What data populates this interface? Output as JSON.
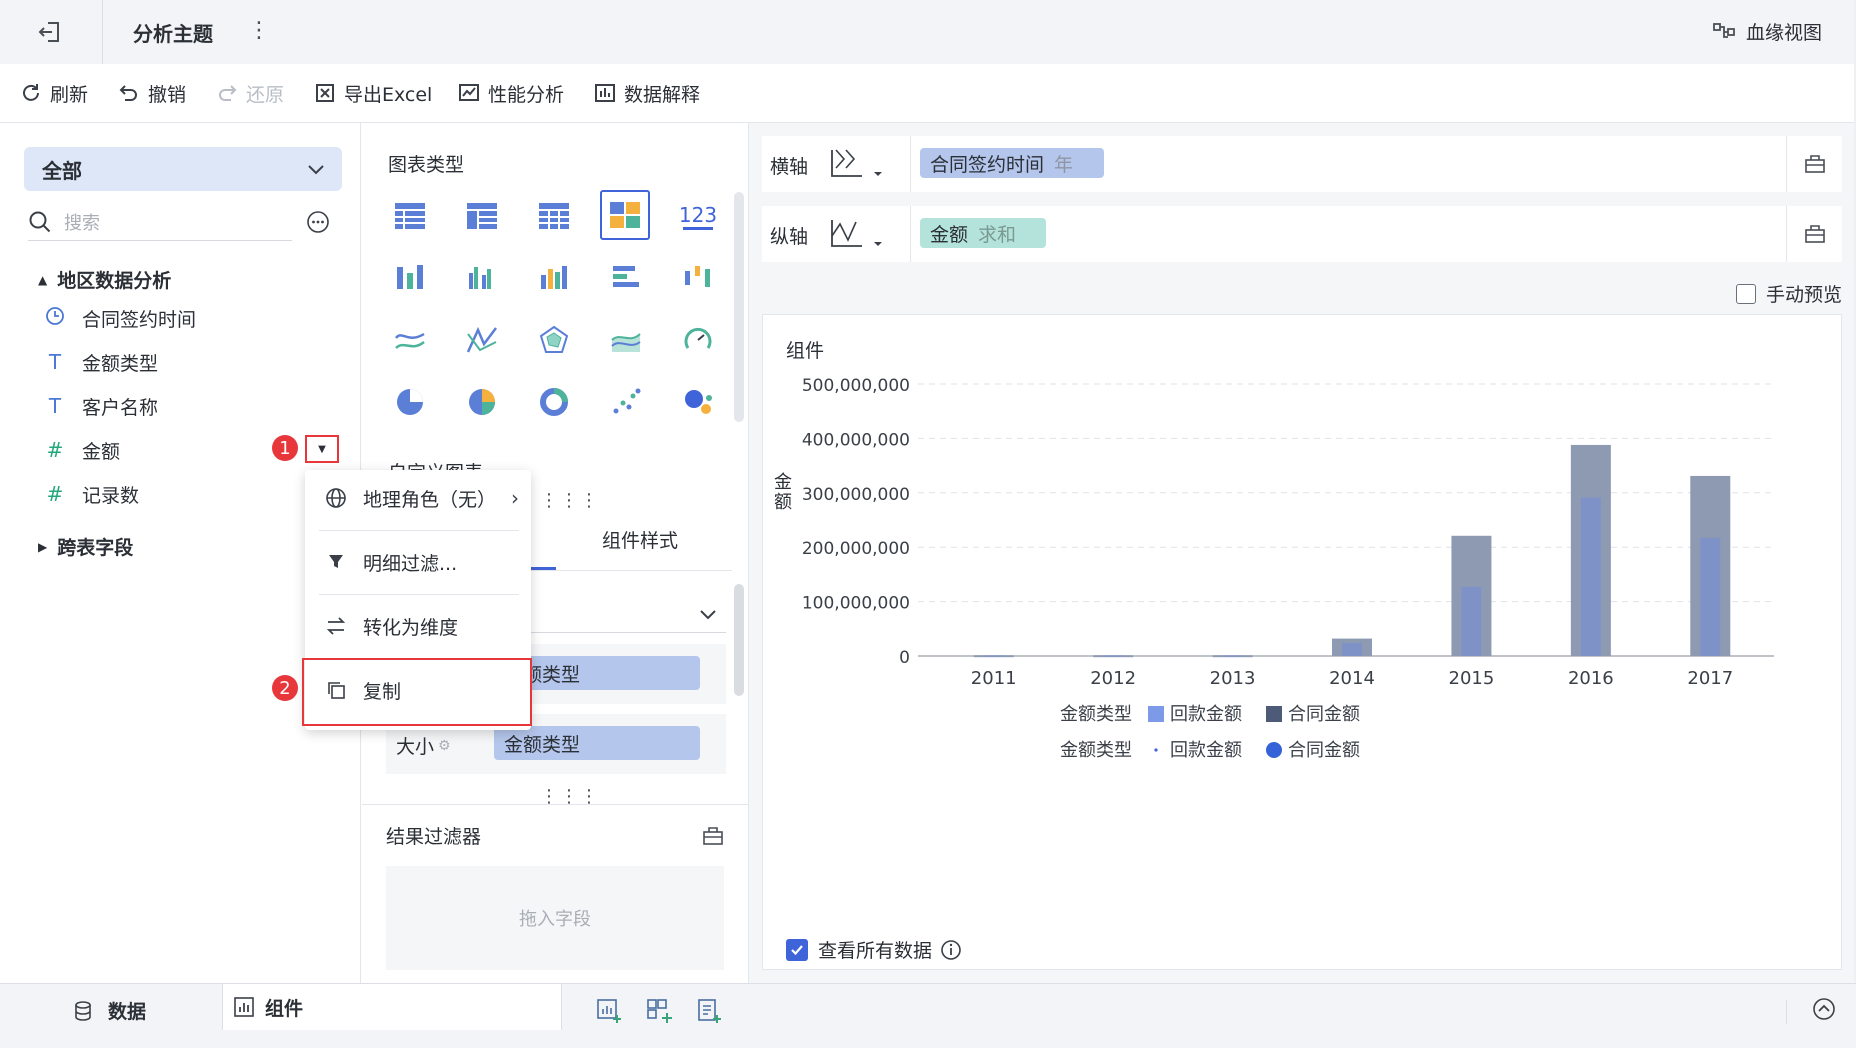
{
  "header": {
    "title": "分析主题",
    "lineage_label": "血缘视图"
  },
  "toolbar": {
    "refresh": "刷新",
    "undo": "撤销",
    "redo": "还原",
    "export_excel": "导出Excel",
    "performance": "性能分析",
    "data_explain": "数据解释"
  },
  "left": {
    "dropdown_value": "全部",
    "search_placeholder": "搜索",
    "folder": "地区数据分析",
    "fields": [
      {
        "label": "合同签约时间",
        "icon": "clock-icon"
      },
      {
        "label": "金额类型",
        "icon": "text-type-icon"
      },
      {
        "label": "客户名称",
        "icon": "text-type-icon"
      },
      {
        "label": "金额",
        "icon": "number-type-icon"
      },
      {
        "label": "记录数",
        "icon": "number-calc-icon"
      }
    ],
    "cross_table": "跨表字段"
  },
  "context_menu": {
    "geo_role": "地理角色（无）",
    "detail_filter": "明细过滤...",
    "to_dimension": "转化为维度",
    "copy": "复制"
  },
  "annotations": {
    "step1": "1",
    "step2": "2"
  },
  "middle": {
    "chart_type_title": "图表类型",
    "number_icon_text": "123",
    "custom_chart_partial": "自定义图表",
    "tab_component_style": "组件样式",
    "mark_color_field": "金额类型",
    "size_label": "大小",
    "size_field": "金额类型",
    "result_filter_title": "结果过滤器",
    "drop_placeholder": "拖入字段"
  },
  "axes": {
    "x_label": "横轴",
    "y_label": "纵轴",
    "x_field": "合同签约时间",
    "x_field_suffix": "年",
    "y_field": "金额",
    "y_field_suffix": "求和",
    "manual_preview": "手动预览"
  },
  "chart_card": {
    "title": "组件",
    "view_all_data": "查看所有数据"
  },
  "chart_data": {
    "type": "bar",
    "ylabel": "金额",
    "ylim": [
      0,
      500000000
    ],
    "yticks": [
      "500,000,000",
      "400,000,000",
      "300,000,000",
      "200,000,000",
      "100,000,000",
      "0"
    ],
    "categories": [
      "2011",
      "2012",
      "2013",
      "2014",
      "2015",
      "2016",
      "2017"
    ],
    "series": [
      {
        "name": "合同金额",
        "color": "#8e9ab2",
        "values": [
          1500000,
          1500000,
          1500000,
          32000000,
          221000000,
          388000000,
          331000000
        ]
      },
      {
        "name": "回款金额",
        "color": "#7f92c8",
        "values": [
          1000000,
          1000000,
          1000000,
          24000000,
          127000000,
          291000000,
          217000000
        ]
      }
    ],
    "legend_rows": [
      {
        "title": "金额类型",
        "items": [
          {
            "label": "回款金额",
            "shape": "square",
            "color": "#7c9ae8"
          },
          {
            "label": "合同金额",
            "shape": "square",
            "color": "#4d5a78"
          }
        ]
      },
      {
        "title": "金额类型",
        "items": [
          {
            "label": "回款金额",
            "shape": "small-dot",
            "color": "#3f63d8"
          },
          {
            "label": "合同金额",
            "shape": "circle",
            "color": "#3562d9"
          }
        ]
      }
    ]
  },
  "bottom": {
    "data_tab": "数据",
    "component_tab": "组件"
  }
}
